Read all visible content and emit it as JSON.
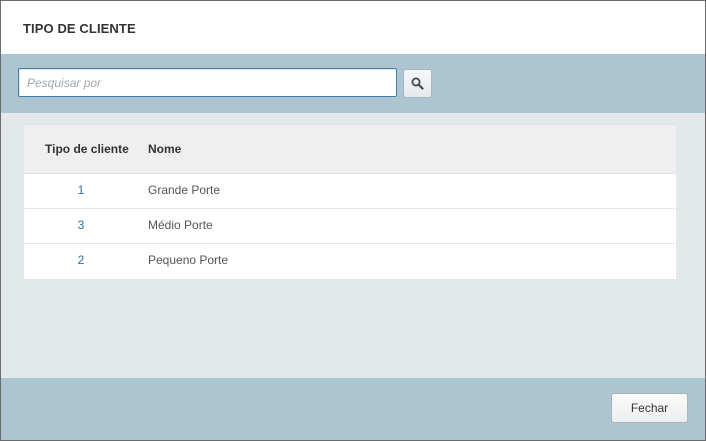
{
  "dialog": {
    "title": "TIPO DE CLIENTE"
  },
  "search": {
    "placeholder": "Pesquisar por",
    "value": "",
    "button_icon": "search-icon"
  },
  "table": {
    "columns": [
      "Tipo de cliente",
      "Nome"
    ],
    "rows": [
      {
        "code": "1",
        "name": "Grande Porte"
      },
      {
        "code": "3",
        "name": "Médio Porte"
      },
      {
        "code": "2",
        "name": "Pequeno Porte"
      }
    ]
  },
  "footer": {
    "close_label": "Fechar"
  },
  "colors": {
    "band": "#adc4d1",
    "body": "#e3e8eb",
    "link": "#2e6da4",
    "input_border": "#3e7fa8"
  }
}
